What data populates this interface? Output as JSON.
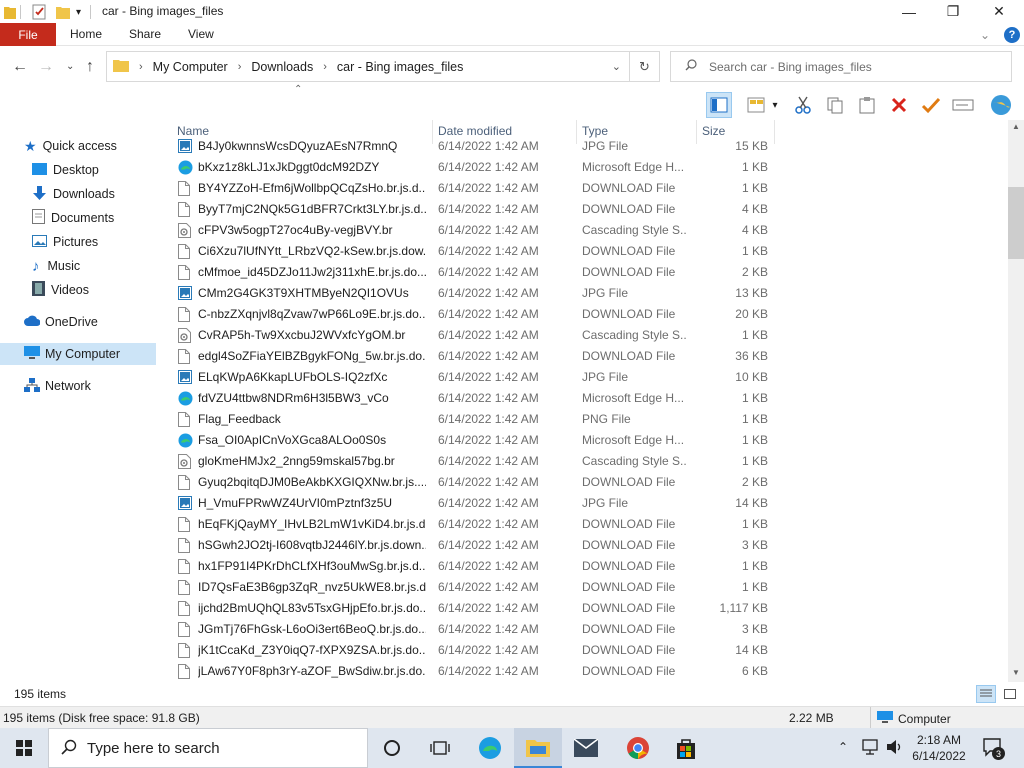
{
  "window": {
    "title": "car - Bing images_files",
    "controls": {
      "minimize": "—",
      "maximize": "❐",
      "close": "✕"
    }
  },
  "ribbon": {
    "tabs": [
      "File",
      "Home",
      "Share",
      "View"
    ],
    "help": "?"
  },
  "address": {
    "breadcrumb": [
      "My Computer",
      "Downloads",
      "car - Bing images_files"
    ],
    "search_placeholder": "Search car - Bing images_files"
  },
  "navpane": {
    "quick_access": "Quick access",
    "items": [
      {
        "label": "Desktop",
        "icon": "desktop-icon",
        "pinned": true
      },
      {
        "label": "Downloads",
        "icon": "downloads-icon",
        "pinned": true
      },
      {
        "label": "Documents",
        "icon": "documents-icon",
        "pinned": true
      },
      {
        "label": "Pictures",
        "icon": "pictures-icon",
        "pinned": true
      },
      {
        "label": "Music",
        "icon": "music-icon",
        "pinned": false
      },
      {
        "label": "Videos",
        "icon": "videos-icon",
        "pinned": false
      }
    ],
    "onedrive": "OneDrive",
    "mycomputer": "My Computer",
    "network": "Network"
  },
  "columns": {
    "name": "Name",
    "date": "Date modified",
    "type": "Type",
    "size": "Size"
  },
  "files": [
    {
      "name": "B4Jy0kwnnsWcsDQyuzAEsN7RmnQ",
      "date": "6/14/2022 1:42 AM",
      "type": "JPG File",
      "size": "15 KB",
      "icon": "image"
    },
    {
      "name": "bKxz1z8kLJ1xJkDggt0dcM92DZY",
      "date": "6/14/2022 1:42 AM",
      "type": "Microsoft Edge H...",
      "size": "1 KB",
      "icon": "edge"
    },
    {
      "name": "BY4YZZoH-Efm6jWollbpQCqZsHo.br.js.d...",
      "date": "6/14/2022 1:42 AM",
      "type": "DOWNLOAD File",
      "size": "1 KB",
      "icon": "file"
    },
    {
      "name": "ByyT7mjC2NQk5G1dBFR7Crkt3LY.br.js.d...",
      "date": "6/14/2022 1:42 AM",
      "type": "DOWNLOAD File",
      "size": "4 KB",
      "icon": "file"
    },
    {
      "name": "cFPV3w5ogpT27oc4uBy-vegjBVY.br",
      "date": "6/14/2022 1:42 AM",
      "type": "Cascading Style S...",
      "size": "4 KB",
      "icon": "css"
    },
    {
      "name": "Ci6Xzu7lUfNYtt_LRbzVQ2-kSew.br.js.dow...",
      "date": "6/14/2022 1:42 AM",
      "type": "DOWNLOAD File",
      "size": "1 KB",
      "icon": "file"
    },
    {
      "name": "cMfmoe_id45DZJo11Jw2j311xhE.br.js.do...",
      "date": "6/14/2022 1:42 AM",
      "type": "DOWNLOAD File",
      "size": "2 KB",
      "icon": "file"
    },
    {
      "name": "CMm2G4GK3T9XHTMByeN2QI1OVUs",
      "date": "6/14/2022 1:42 AM",
      "type": "JPG File",
      "size": "13 KB",
      "icon": "image"
    },
    {
      "name": "C-nbzZXqnjvl8qZvaw7wP66Lo9E.br.js.do...",
      "date": "6/14/2022 1:42 AM",
      "type": "DOWNLOAD File",
      "size": "20 KB",
      "icon": "file"
    },
    {
      "name": "CvRAP5h-Tw9XxcbuJ2WVxfcYgOM.br",
      "date": "6/14/2022 1:42 AM",
      "type": "Cascading Style S...",
      "size": "1 KB",
      "icon": "css"
    },
    {
      "name": "edgl4SoZFiaYElBZBgykFONg_5w.br.js.do...",
      "date": "6/14/2022 1:42 AM",
      "type": "DOWNLOAD File",
      "size": "36 KB",
      "icon": "file"
    },
    {
      "name": "ELqKWpA6KkapLUFbOLS-IQ2zfXc",
      "date": "6/14/2022 1:42 AM",
      "type": "JPG File",
      "size": "10 KB",
      "icon": "image"
    },
    {
      "name": "fdVZU4ttbw8NDRm6H3l5BW3_vCo",
      "date": "6/14/2022 1:42 AM",
      "type": "Microsoft Edge H...",
      "size": "1 KB",
      "icon": "edge"
    },
    {
      "name": "Flag_Feedback",
      "date": "6/14/2022 1:42 AM",
      "type": "PNG File",
      "size": "1 KB",
      "icon": "file"
    },
    {
      "name": "Fsa_OI0ApICnVoXGca8ALOo0S0s",
      "date": "6/14/2022 1:42 AM",
      "type": "Microsoft Edge H...",
      "size": "1 KB",
      "icon": "edge"
    },
    {
      "name": "gloKmeHMJx2_2nng59mskal57bg.br",
      "date": "6/14/2022 1:42 AM",
      "type": "Cascading Style S...",
      "size": "1 KB",
      "icon": "css"
    },
    {
      "name": "Gyuq2bqitqDJM0BeAkbKXGIQXNw.br.js....",
      "date": "6/14/2022 1:42 AM",
      "type": "DOWNLOAD File",
      "size": "2 KB",
      "icon": "file"
    },
    {
      "name": "H_VmuFPRwWZ4UrVI0mPztnf3z5U",
      "date": "6/14/2022 1:42 AM",
      "type": "JPG File",
      "size": "14 KB",
      "icon": "image"
    },
    {
      "name": "hEqFKjQayMY_IHvLB2LmW1vKiD4.br.js.d...",
      "date": "6/14/2022 1:42 AM",
      "type": "DOWNLOAD File",
      "size": "1 KB",
      "icon": "file"
    },
    {
      "name": "hSGwh2JO2tj-I608vqtbJ2446lY.br.js.down...",
      "date": "6/14/2022 1:42 AM",
      "type": "DOWNLOAD File",
      "size": "3 KB",
      "icon": "file"
    },
    {
      "name": "hx1FP91I4PKrDhCLfXHf3ouMwSg.br.js.d...",
      "date": "6/14/2022 1:42 AM",
      "type": "DOWNLOAD File",
      "size": "1 KB",
      "icon": "file"
    },
    {
      "name": "ID7QsFaE3B6gp3ZqR_nvz5UkWE8.br.js.do...",
      "date": "6/14/2022 1:42 AM",
      "type": "DOWNLOAD File",
      "size": "1 KB",
      "icon": "file"
    },
    {
      "name": "ijchd2BmUQhQL83v5TsxGHjpEfo.br.js.do...",
      "date": "6/14/2022 1:42 AM",
      "type": "DOWNLOAD File",
      "size": "1,117 KB",
      "icon": "file"
    },
    {
      "name": "JGmTj76FhGsk-L6oOi3ert6BeoQ.br.js.do...",
      "date": "6/14/2022 1:42 AM",
      "type": "DOWNLOAD File",
      "size": "3 KB",
      "icon": "file"
    },
    {
      "name": "jK1tCcaKd_Z3Y0iqQ7-fXPX9ZSA.br.js.do...",
      "date": "6/14/2022 1:42 AM",
      "type": "DOWNLOAD File",
      "size": "14 KB",
      "icon": "file"
    },
    {
      "name": "jLAw67Y0F8ph3rY-aZOF_BwSdiw.br.js.do...",
      "date": "6/14/2022 1:42 AM",
      "type": "DOWNLOAD File",
      "size": "6 KB",
      "icon": "file"
    }
  ],
  "status": {
    "items": "195 items",
    "info": "195 items (Disk free space: 91.8 GB)",
    "size": "2.22 MB",
    "location": "Computer"
  },
  "taskbar": {
    "search_placeholder": "Type here to search",
    "time": "2:18 AM",
    "date": "6/14/2022",
    "notif_count": "3"
  },
  "colors": {
    "file_tab": "#c42b1c",
    "selection": "#cce4f7",
    "taskbar": "#dfe6ef"
  }
}
